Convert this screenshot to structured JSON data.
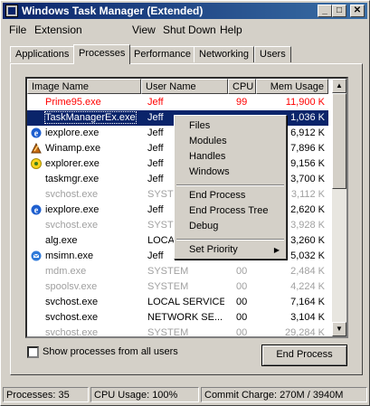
{
  "window": {
    "title": "Windows Task Manager (Extended)"
  },
  "title_buttons": {
    "minimize": "_",
    "maximize": "□",
    "close": "✕"
  },
  "menubar": [
    "File",
    "Extension",
    "View",
    "Shut Down",
    "Help"
  ],
  "tabs": [
    "Applications",
    "Processes",
    "Performance",
    "Networking",
    "Users"
  ],
  "active_tab": "Processes",
  "columns": [
    "Image Name",
    "User Name",
    "CPU",
    "Mem Usage"
  ],
  "processes": [
    {
      "image": "Prime95.exe",
      "user": "Jeff",
      "cpu": "99",
      "mem": "11,900 K",
      "style": "red",
      "icon": ""
    },
    {
      "image": "TaskManagerEx.exe",
      "user": "Jeff",
      "cpu": "",
      "mem": "1,036 K",
      "style": "selected",
      "icon": ""
    },
    {
      "image": "iexplore.exe",
      "user": "Jeff",
      "cpu": "",
      "mem": "6,912 K",
      "style": "",
      "icon": "ie-icon"
    },
    {
      "image": "Winamp.exe",
      "user": "Jeff",
      "cpu": "",
      "mem": "7,896 K",
      "style": "",
      "icon": "winamp-icon"
    },
    {
      "image": "explorer.exe",
      "user": "Jeff",
      "cpu": "",
      "mem": "9,156 K",
      "style": "",
      "icon": "explorer-icon"
    },
    {
      "image": "taskmgr.exe",
      "user": "Jeff",
      "cpu": "",
      "mem": "3,700 K",
      "style": "",
      "icon": ""
    },
    {
      "image": "svchost.exe",
      "user": "SYSTEM",
      "cpu": "",
      "mem": "3,112 K",
      "style": "gray",
      "icon": ""
    },
    {
      "image": "iexplore.exe",
      "user": "Jeff",
      "cpu": "",
      "mem": "2,620 K",
      "style": "",
      "icon": "ie-icon"
    },
    {
      "image": "svchost.exe",
      "user": "SYSTEM",
      "cpu": "",
      "mem": "3,928 K",
      "style": "gray",
      "icon": ""
    },
    {
      "image": "alg.exe",
      "user": "LOCAL SERVICE",
      "cpu": "",
      "mem": "3,260 K",
      "style": "",
      "icon": ""
    },
    {
      "image": "msimn.exe",
      "user": "Jeff",
      "cpu": "",
      "mem": "5,032 K",
      "style": "",
      "icon": "msimn-icon"
    },
    {
      "image": "mdm.exe",
      "user": "SYSTEM",
      "cpu": "00",
      "mem": "2,484 K",
      "style": "gray",
      "icon": ""
    },
    {
      "image": "spoolsv.exe",
      "user": "SYSTEM",
      "cpu": "00",
      "mem": "4,224 K",
      "style": "gray",
      "icon": ""
    },
    {
      "image": "svchost.exe",
      "user": "LOCAL SERVICE",
      "cpu": "00",
      "mem": "7,164 K",
      "style": "",
      "icon": ""
    },
    {
      "image": "svchost.exe",
      "user": "NETWORK SE...",
      "cpu": "00",
      "mem": "3,104 K",
      "style": "",
      "icon": ""
    },
    {
      "image": "svchost.exe",
      "user": "SYSTEM",
      "cpu": "00",
      "mem": "29,284 K",
      "style": "gray",
      "icon": ""
    }
  ],
  "context_menu": {
    "items": [
      "Files",
      "Modules",
      "Handles",
      "Windows",
      "End Process",
      "End Process Tree",
      "Debug",
      "Set Priority"
    ],
    "submenu_arrow": "▶"
  },
  "scrollbar": {
    "up": "▲",
    "down": "▼"
  },
  "show_all_label": "Show processes from all users",
  "end_process_label": "End Process",
  "status": {
    "processes": "Processes: 35",
    "cpu": "CPU Usage: 100%",
    "commit": "Commit Charge: 270M / 3940M"
  },
  "colors": {
    "title_start": "#0a246a",
    "title_end": "#3a6ea5",
    "selection": "#0a246a",
    "high_cpu": "#ff0000",
    "system_process": "#a0a0a0"
  }
}
